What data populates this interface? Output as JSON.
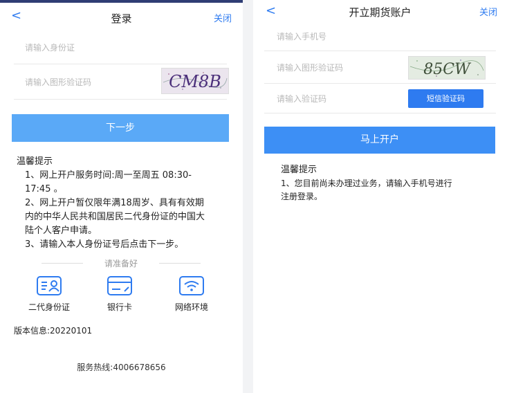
{
  "left": {
    "header": {
      "back": "<",
      "title": "登录",
      "close": "关闭"
    },
    "id_field": {
      "placeholder": "请输入身份证"
    },
    "captcha_field": {
      "placeholder": "请输入图形验证码",
      "captcha_text": "CM8B"
    },
    "next_button": "下一步",
    "tips": {
      "title": "温馨提示",
      "lines": [
        "1、网上开户服务时间:周一至周五 08:30-",
        "17:45 。",
        "2、网上开户暂仅限年满18周岁、具有有效期",
        "内的中华人民共和国居民二代身份证的中国大",
        "陆个人客户申请。",
        "3、请输入本人身份证号后点击下一步。"
      ]
    },
    "prepare": {
      "title": "请准备好",
      "items": [
        {
          "label": "二代身份证",
          "icon": "id-card-icon"
        },
        {
          "label": "银行卡",
          "icon": "bank-card-icon"
        },
        {
          "label": "网络环境",
          "icon": "wifi-icon"
        }
      ]
    },
    "version": "版本信息:20220101",
    "hotline": "服务热线:4006678656"
  },
  "right": {
    "header": {
      "back": "<",
      "title": "开立期货账户",
      "close": "关闭"
    },
    "phone_field": {
      "placeholder": "请输入手机号"
    },
    "captcha_field": {
      "placeholder": "请输入图形验证码",
      "captcha_text": "85CW"
    },
    "sms_field": {
      "placeholder": "请输入验证码"
    },
    "sms_button": "短信验证码",
    "open_button": "马上开户",
    "tips": {
      "title": "温馨提示",
      "lines": [
        "1、您目前尚未办理过业务，请输入手机号进行",
        "注册登录。"
      ]
    }
  },
  "colors": {
    "accent": "#2e7bf0",
    "button": "#5aa9f7",
    "topbar": "#2f3d74"
  }
}
